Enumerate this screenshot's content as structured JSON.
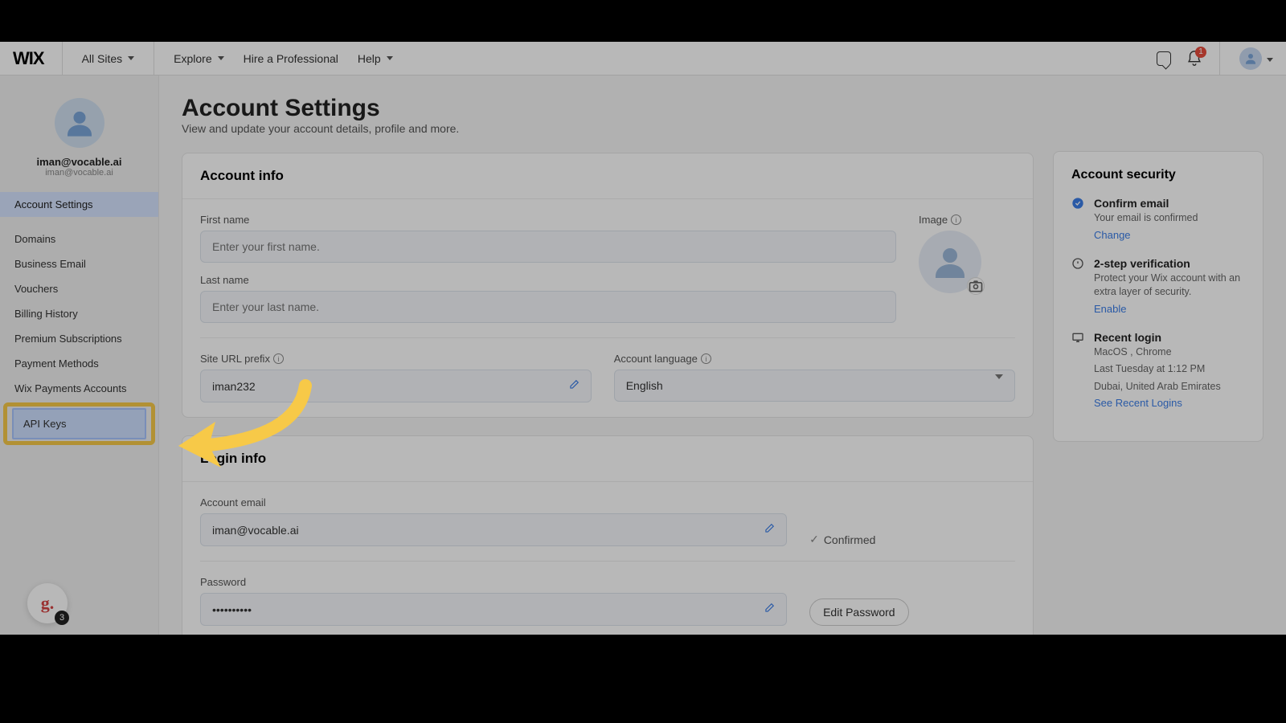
{
  "topbar": {
    "logo": "WIX",
    "nav": {
      "allsites": "All Sites",
      "explore": "Explore",
      "hire": "Hire a Professional",
      "help": "Help"
    },
    "notif_count": "1"
  },
  "sidebar": {
    "email": "iman@vocable.ai",
    "subemail": "iman@vocable.ai",
    "items": {
      "account_settings": "Account Settings",
      "domains": "Domains",
      "business_email": "Business Email",
      "vouchers": "Vouchers",
      "billing": "Billing History",
      "premium": "Premium Subscriptions",
      "payment_methods": "Payment Methods",
      "wix_payments": "Wix Payments Accounts",
      "api_keys": "API Keys"
    }
  },
  "page": {
    "title": "Account Settings",
    "subtitle": "View and update your account details, profile and more."
  },
  "account_info": {
    "heading": "Account info",
    "first_name_label": "First name",
    "first_name_placeholder": "Enter your first name.",
    "last_name_label": "Last name",
    "last_name_placeholder": "Enter your last name.",
    "image_label": "Image",
    "url_prefix_label": "Site URL prefix",
    "url_prefix_value": "iman232",
    "lang_label": "Account language",
    "lang_value": "English"
  },
  "login_info": {
    "heading": "Login info",
    "email_label": "Account email",
    "email_value": "iman@vocable.ai",
    "confirmed": "Confirmed",
    "password_label": "Password",
    "password_value": "••••••••••",
    "edit_password": "Edit Password"
  },
  "security": {
    "heading": "Account security",
    "confirm_title": "Confirm email",
    "confirm_text": "Your email is confirmed",
    "confirm_link": "Change",
    "twostep_title": "2-step verification",
    "twostep_text": "Protect your Wix account with an extra layer of security.",
    "twostep_link": "Enable",
    "recent_title": "Recent login",
    "recent_l1": "MacOS , Chrome",
    "recent_l2": "Last Tuesday at 1:12 PM",
    "recent_l3": "Dubai, United Arab Emirates",
    "recent_link": "See Recent Logins"
  },
  "grammarly_count": "3"
}
